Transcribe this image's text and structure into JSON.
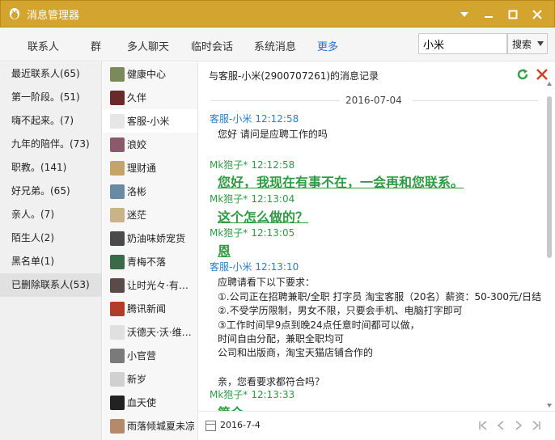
{
  "window": {
    "title": "消息管理器",
    "controls": [
      "菜单",
      "最小化",
      "最大化",
      "关闭"
    ]
  },
  "tabs": [
    {
      "label": "联系人"
    },
    {
      "label": "群"
    },
    {
      "label": "多人聊天"
    },
    {
      "label": "临时会话"
    },
    {
      "label": "系统消息"
    },
    {
      "label": "更多",
      "active": true
    }
  ],
  "search": {
    "value": "小米",
    "button": "搜索"
  },
  "groups": [
    {
      "label": "最近联系人(65)"
    },
    {
      "label": "第一阶段。(51)"
    },
    {
      "label": "嗨不起来。(7)"
    },
    {
      "label": "九年的陪伴。(73)"
    },
    {
      "label": "职教。(141)"
    },
    {
      "label": "好兄弟。(65)"
    },
    {
      "label": "亲人。(7)"
    },
    {
      "label": "陌生人(2)"
    },
    {
      "label": "黑名单(1)"
    },
    {
      "label": "已删除联系人(53)",
      "selected": true
    }
  ],
  "contacts": [
    {
      "name": "健康中心",
      "color": "#7a8a5a"
    },
    {
      "name": "久伴",
      "color": "#6b2a2a"
    },
    {
      "name": "客服-小米",
      "color": "#e6e6e6",
      "selected": true
    },
    {
      "name": "浪姣",
      "color": "#8a5a6a"
    },
    {
      "name": "理财通",
      "color": "#c4a46a"
    },
    {
      "name": "洛彬",
      "color": "#6a8aa4"
    },
    {
      "name": "迷茫",
      "color": "#c9b48a"
    },
    {
      "name": "奶油味娇宠货",
      "color": "#4a4a4a"
    },
    {
      "name": "青梅不落",
      "color": "#3a6a4a"
    },
    {
      "name": "让时光々·有…",
      "color": "#5a4a4a"
    },
    {
      "name": "腾讯新闻",
      "color": "#b43a2a"
    },
    {
      "name": "沃德天·沃·维…",
      "color": "#e0e0e0"
    },
    {
      "name": "小官营",
      "color": "#7a7a7a"
    },
    {
      "name": "新岁",
      "color": "#d0d0d0"
    },
    {
      "name": "血天使",
      "color": "#222222"
    },
    {
      "name": "雨落倾城夏未凉",
      "color": "#b48a6a"
    }
  ],
  "chat": {
    "header": "与客服-小米(2900707261)的消息记录",
    "date": "2016-07-04",
    "messages": [
      {
        "sender": "客服-小米",
        "time": "12:12:58",
        "type": "other",
        "lines": [
          "您好  请问是应聘工作的吗"
        ]
      },
      {
        "sender": "Mk狍子*",
        "time": "12:12:58",
        "type": "self",
        "lines": [
          "您好，我现在有事不在，一会再和您联系。"
        ]
      },
      {
        "sender": "Mk狍子*",
        "time": "12:13:04",
        "type": "self",
        "lines": [
          "这个怎么做的？"
        ]
      },
      {
        "sender": "Mk狍子*",
        "time": "12:13:05",
        "type": "self",
        "lines": [
          "恩"
        ]
      },
      {
        "sender": "客服-小米",
        "time": "12:13:10",
        "type": "other",
        "lines": [
          "应聘请看下以下要求：",
          "①.公司正在招聘兼职/全职 打字员 淘宝客服（20名）薪资：50-300元/日结",
          "②.不受学历限制，男女不限，只要会手机、电脑打字即可",
          "③工作时间早9点到晚24点任意时间都可以做，",
          "时间自由分配，兼职全职均可",
          "公司和出版商，淘宝天猫店铺合作的",
          "",
          "亲，您看要求都符合吗？"
        ]
      },
      {
        "sender": "Mk狍子*",
        "time": "12:13:33",
        "type": "self",
        "lines": [
          "简介"
        ]
      }
    ]
  },
  "footer": {
    "date": "2016-7-4"
  },
  "colors": {
    "titlebar": "#d4a52e",
    "accent_blue": "#2a7fc9",
    "accent_green": "#2e9b44"
  }
}
